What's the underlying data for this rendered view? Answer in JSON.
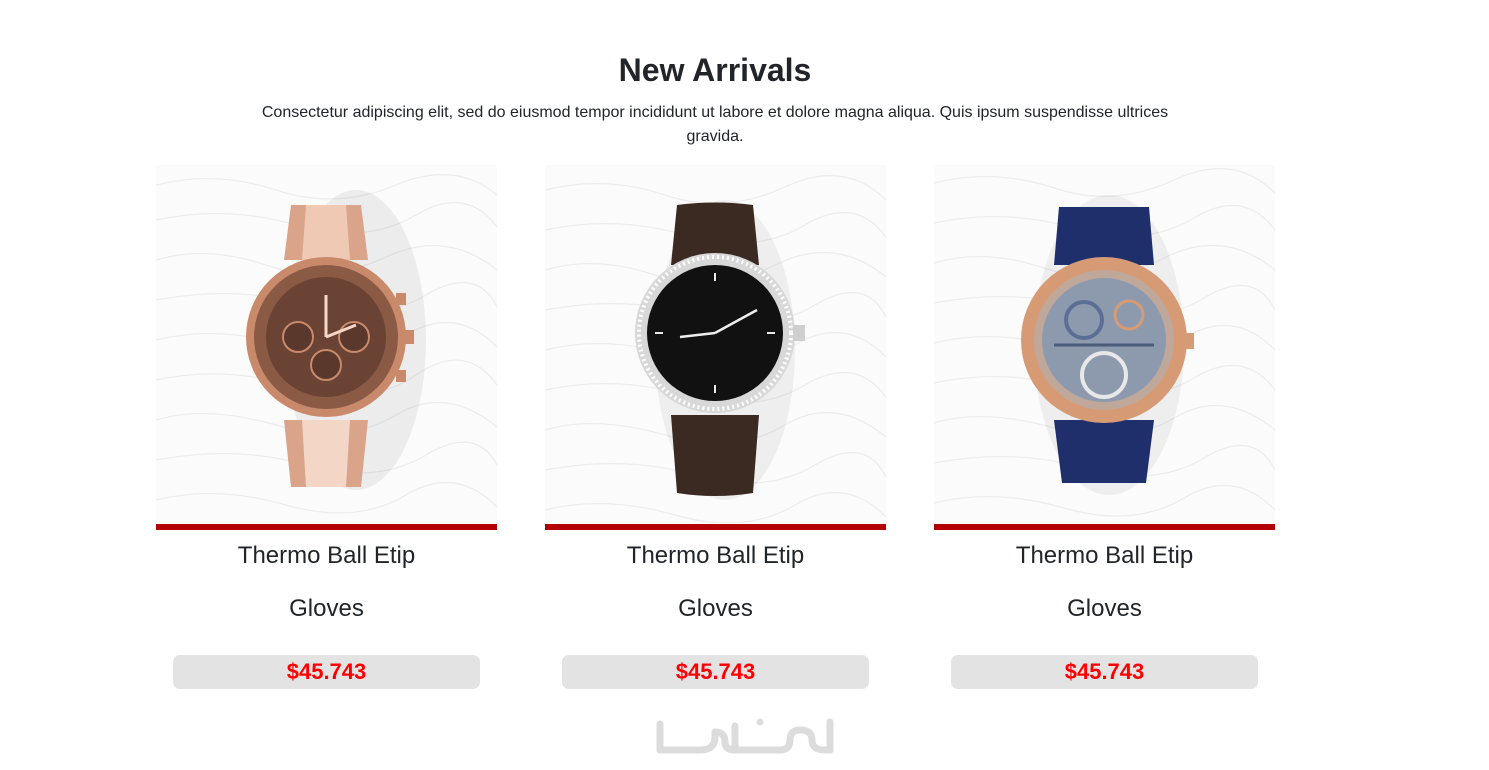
{
  "section": {
    "title": "New Arrivals",
    "description": "Consectetur adipiscing elit, sed do eiusmod tempor incididunt ut labore et dolore magna aliqua. Quis ipsum suspendisse ultrices gravida."
  },
  "products": [
    {
      "name": "Thermo Ball Etip",
      "subtitle": "Gloves",
      "price": "$45.743",
      "image": "rose-gold-chronograph-watch"
    },
    {
      "name": "Thermo Ball Etip",
      "subtitle": "Gloves",
      "price": "$45.743",
      "image": "black-dial-leather-watch"
    },
    {
      "name": "Thermo Ball Etip",
      "subtitle": "Gloves",
      "price": "$45.743",
      "image": "skeleton-blue-strap-watch"
    }
  ],
  "colors": {
    "accent_bar": "#b30000",
    "price_text": "#ff0000",
    "price_bg": "#e3e3e3"
  },
  "watermark": {
    "text": "خمسات"
  }
}
